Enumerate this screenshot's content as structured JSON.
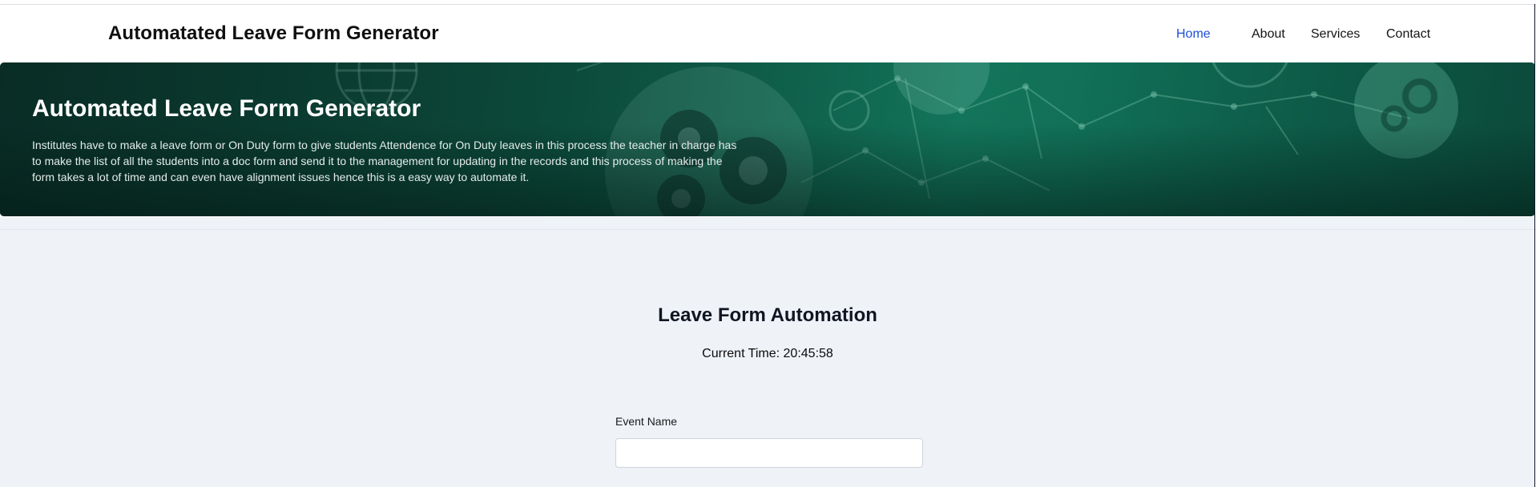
{
  "header": {
    "brand": "Automatated Leave Form Generator",
    "nav": [
      {
        "label": "Home",
        "active": true
      },
      {
        "label": "About",
        "active": false
      },
      {
        "label": "Services",
        "active": false
      },
      {
        "label": "Contact",
        "active": false
      }
    ]
  },
  "hero": {
    "title": "Automated Leave Form Generator",
    "description": "Institutes have to make a leave form or On Duty form to give students Attendence for On Duty leaves in this process the teacher in charge has to make the list of all the students into a doc form and send it to the management for updating in the records and this process of making the form takes a lot of time and can even have alignment issues hence this is a easy way to automate it.",
    "background_icons": [
      "globe-icon",
      "gears-icon",
      "network-icon",
      "gear-badge-icon"
    ]
  },
  "main": {
    "title": "Leave Form Automation",
    "current_time": "Current Time: 20:45:58",
    "fields": [
      {
        "label": "Event Name",
        "value": "",
        "placeholder": ""
      }
    ]
  },
  "colors": {
    "nav_active": "#1d4ed8",
    "hero_bg": "#0f5a47",
    "content_bg": "#eff2f7"
  }
}
